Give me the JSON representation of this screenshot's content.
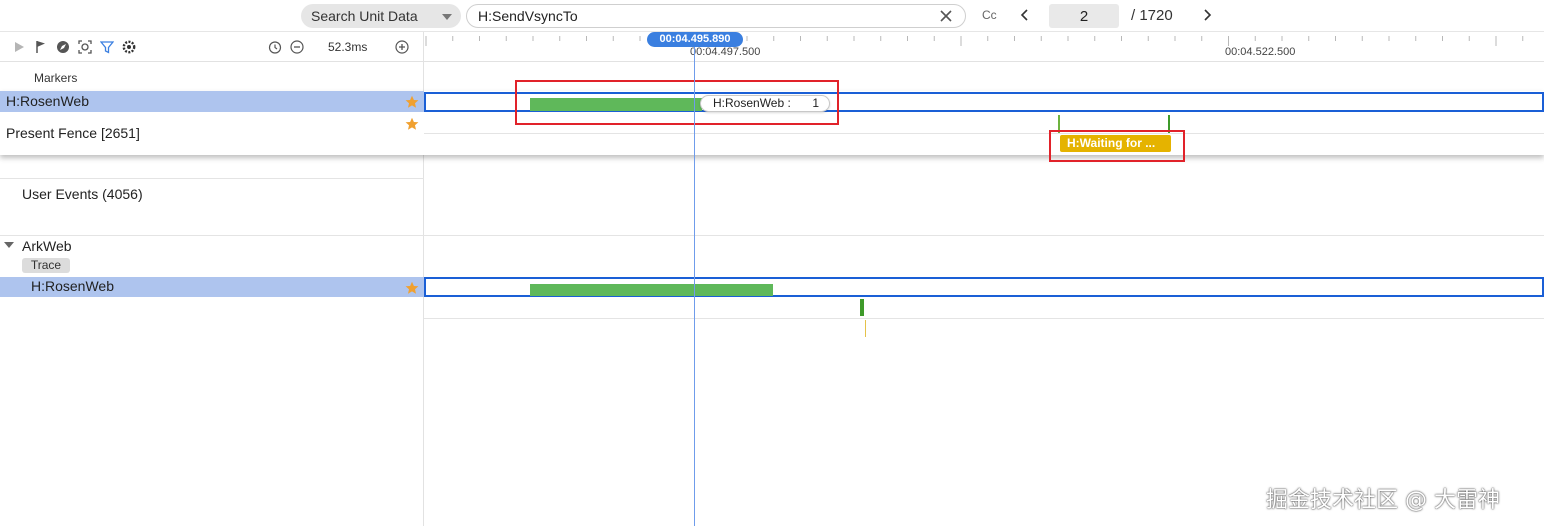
{
  "search": {
    "scope_label": "Search Unit Data",
    "query": "H:SendVsyncTo",
    "case_label": "Cc",
    "current_page": "2",
    "total_pages": "/ 1720"
  },
  "toolbar": {
    "scale": "52.3ms"
  },
  "ruler": {
    "cursor_time": "00:04.495.890",
    "label_1": "00:04.497.500",
    "label_2": "00:04.522.500"
  },
  "rows": {
    "markers": "Markers",
    "pinned_rosen": "H:RosenWeb",
    "present_fence": "Present Fence [2651]",
    "user_events": "User Events (4056)",
    "arkweb": "ArkWeb",
    "trace_chip": "Trace",
    "rosen_child": "H:RosenWeb"
  },
  "slices": {
    "tooltip_name": "H:RosenWeb :",
    "tooltip_count": "1",
    "waiting_label": "H:Waiting for ..."
  },
  "colors": {
    "highlight_row": "#aec4ee",
    "slice_green": "#5fb85a",
    "selection_outline": "#1a5fd6",
    "annotation_red": "#e1222a",
    "waiting_yellow": "#e5b300",
    "star": "#f0a030"
  },
  "watermark": "掘金技术社区 @ 大雷神"
}
